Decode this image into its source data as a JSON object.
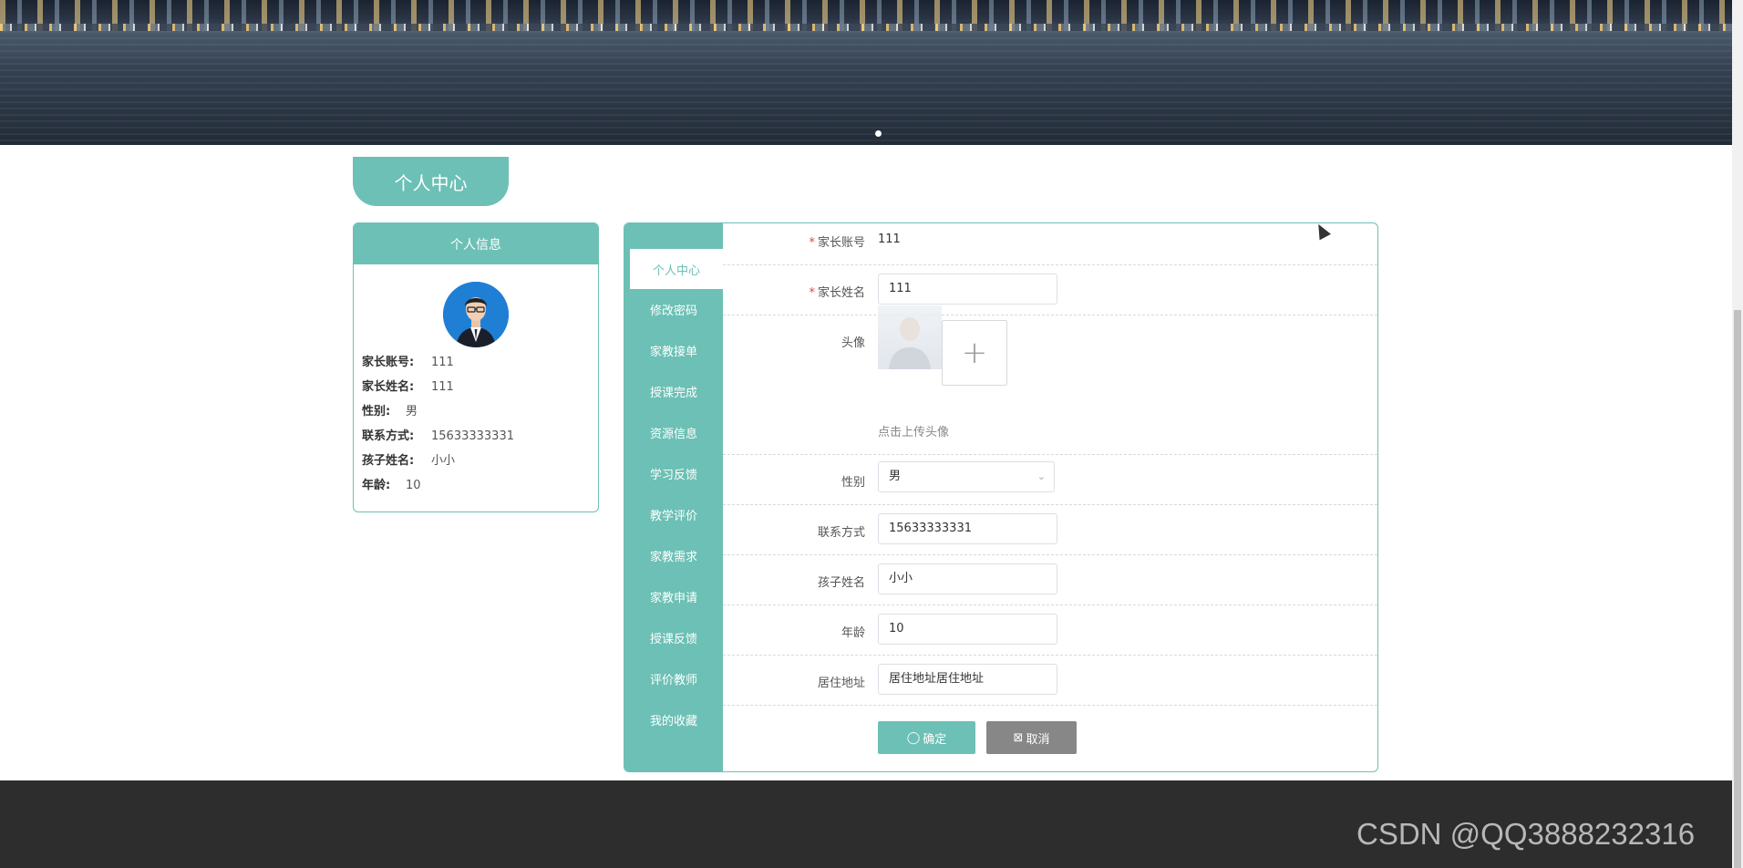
{
  "banner": {
    "image": "night-city-harbor-photo",
    "dot_count": 1
  },
  "page_tab": {
    "label": "个人中心"
  },
  "profile_card": {
    "header": "个人信息",
    "avatar": "man-with-glasses-portrait",
    "rows": [
      {
        "key": "家长账号:",
        "value": "111"
      },
      {
        "key": "家长姓名:",
        "value": "111"
      },
      {
        "key": "性别:",
        "value": "男"
      },
      {
        "key": "联系方式:",
        "value": "15633333331"
      },
      {
        "key": "孩子姓名:",
        "value": "小小"
      },
      {
        "key": "年龄:",
        "value": "10"
      }
    ]
  },
  "menu": {
    "items": [
      "个人中心",
      "修改密码",
      "家教接单",
      "授课完成",
      "资源信息",
      "学习反馈",
      "教学评价",
      "家教需求",
      "家教申请",
      "授课反馈",
      "评价教师",
      "我的收藏"
    ],
    "active_index": 0
  },
  "form": {
    "required_mark": "*",
    "account": {
      "label": "家长账号",
      "value": "111"
    },
    "name": {
      "label": "家长姓名",
      "value": "111"
    },
    "avatar": {
      "label": "头像",
      "upload_symbol": "+",
      "hint": "点击上传头像"
    },
    "gender": {
      "label": "性别",
      "value": "男"
    },
    "phone": {
      "label": "联系方式",
      "value": "15633333331"
    },
    "child_name": {
      "label": "孩子姓名",
      "value": "小小"
    },
    "age": {
      "label": "年龄",
      "value": "10"
    },
    "address": {
      "label": "居住地址",
      "value": "居住地址居住地址"
    },
    "confirm_button": "确定",
    "cancel_button": "取消"
  },
  "footer": {
    "watermark": "CSDN @QQ3888232316"
  },
  "colors": {
    "accent": "#6cc0b5",
    "cancel": "#878787",
    "footer": "#2d2d2d",
    "required": "#e64242"
  }
}
